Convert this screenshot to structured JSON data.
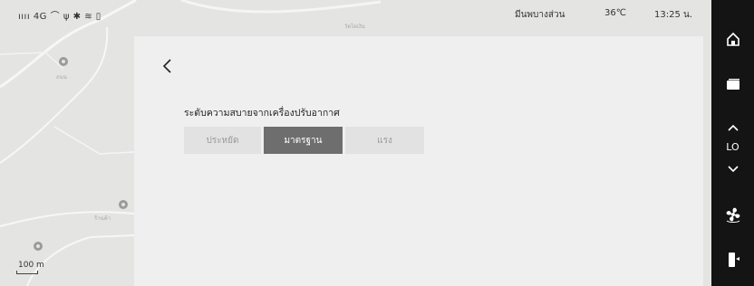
{
  "status_bar": {
    "signal": "4G",
    "location": "มีนพบางส่วน",
    "temperature": "36℃",
    "time": "13:25 น."
  },
  "map": {
    "scale_label": "100 m",
    "place_labels": [
      "ถนน",
      "วัดไผ่เงิน",
      "ร้านค้า"
    ]
  },
  "climate": {
    "section_label": "ระดับความสบายจากเครื่องปรับอากาศ",
    "options": [
      "ประหยัด",
      "มาตรฐาน",
      "แรง"
    ],
    "selected": "มาตรฐาน"
  },
  "sidebar": {
    "temperature_setting": "LO"
  },
  "icons": {
    "back": "chevron-left-icon",
    "home": "home-icon",
    "windows": "window-switch-icon",
    "temp_up": "chevron-up-icon",
    "temp_down": "chevron-down-icon",
    "fan": "fan-icon",
    "seat": "seat-heat-icon"
  }
}
